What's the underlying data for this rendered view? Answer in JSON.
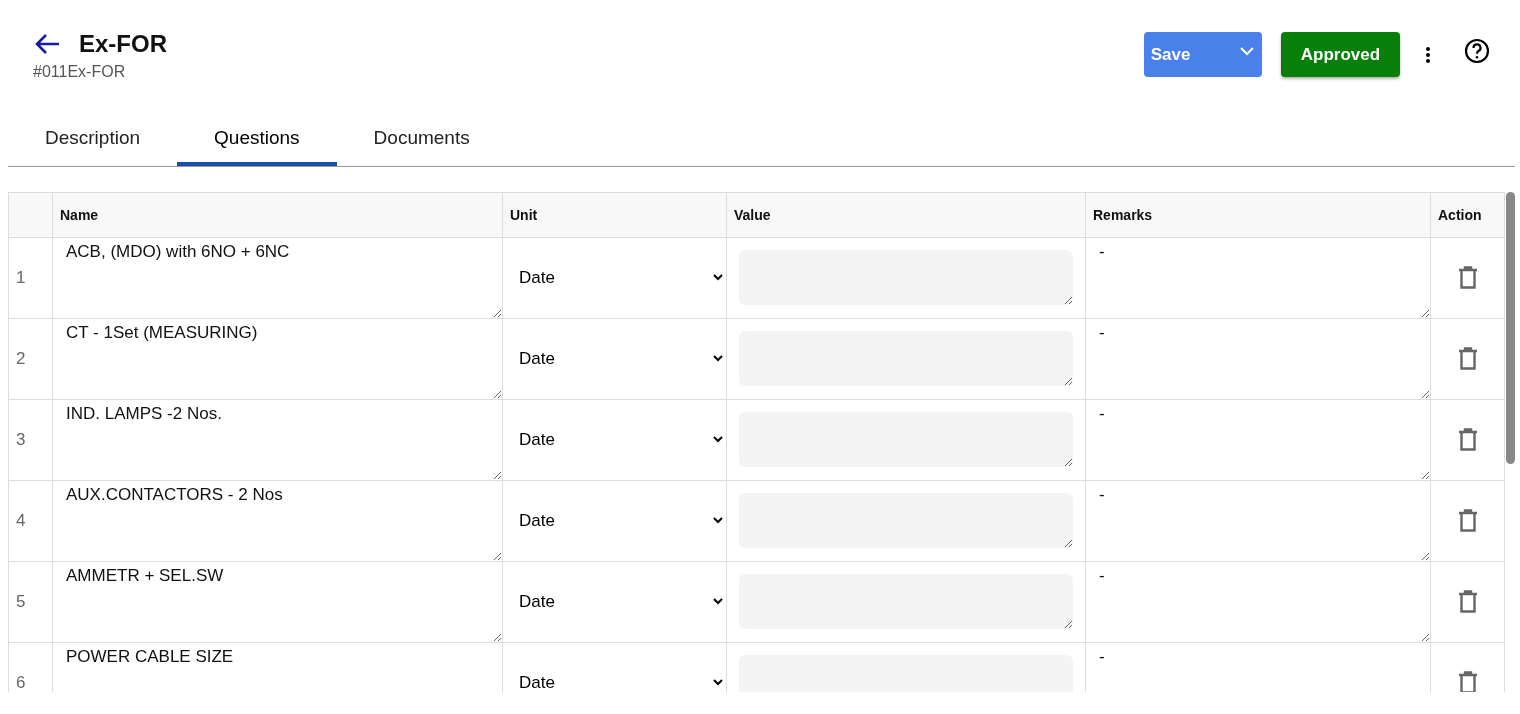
{
  "header": {
    "title": "Ex-FOR",
    "subtitle": "#011Ex-FOR",
    "save_button": "Save",
    "status_button": "Approved"
  },
  "tabs": [
    {
      "label": "Description",
      "selected": false
    },
    {
      "label": "Questions",
      "selected": true
    },
    {
      "label": "Documents",
      "selected": false
    }
  ],
  "table": {
    "columns": [
      "Name",
      "Unit",
      "Value",
      "Remarks",
      "Action"
    ],
    "rows": [
      {
        "index": "1",
        "name": "ACB, (MDO) with 6NO + 6NC",
        "unit": "Date",
        "remarks": "-"
      },
      {
        "index": "2",
        "name": "CT - 1Set (MEASURING)",
        "unit": "Date",
        "remarks": "-"
      },
      {
        "index": "3",
        "name": "IND. LAMPS -2 Nos.",
        "unit": "Date",
        "remarks": "-"
      },
      {
        "index": "4",
        "name": "AUX.CONTACTORS - 2 Nos",
        "unit": "Date",
        "remarks": "-"
      },
      {
        "index": "5",
        "name": "AMMETR + SEL.SW",
        "unit": "Date",
        "remarks": "-"
      },
      {
        "index": "6",
        "name": "POWER CABLE SIZE",
        "unit": "Date",
        "remarks": "-"
      }
    ]
  }
}
